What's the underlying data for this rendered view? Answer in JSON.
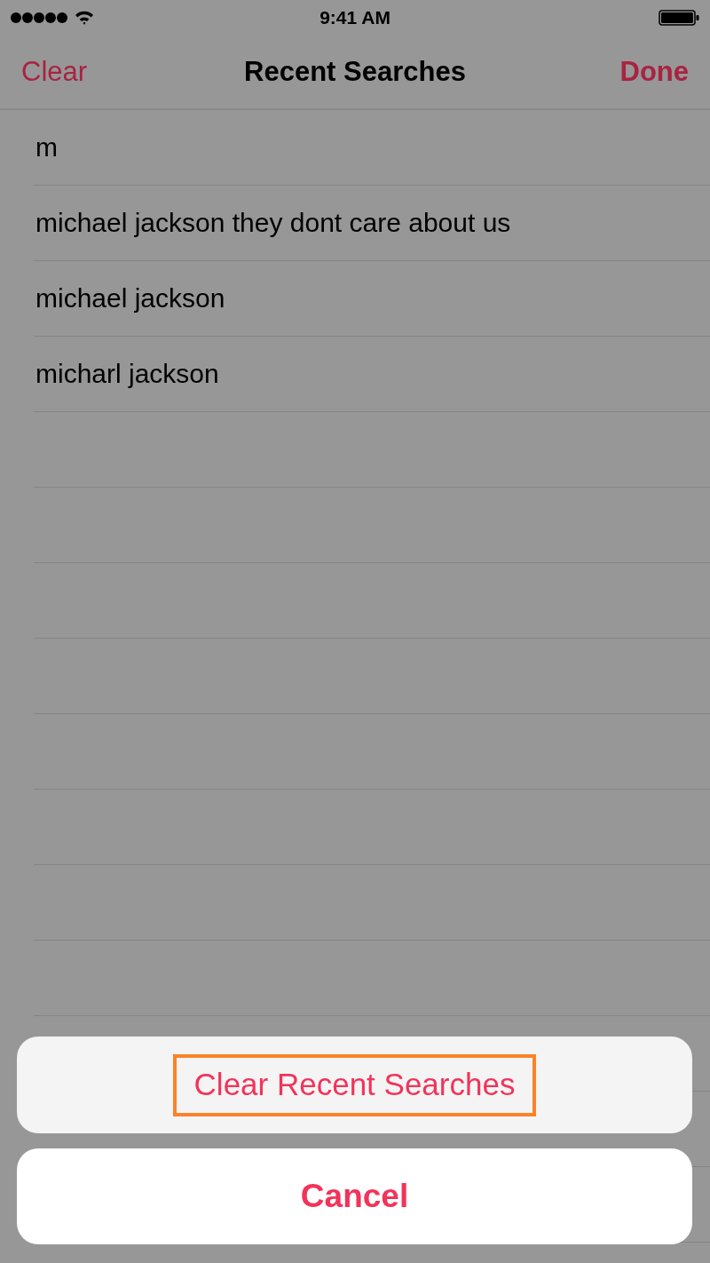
{
  "status_bar": {
    "time": "9:41 AM"
  },
  "nav": {
    "left": "Clear",
    "title": "Recent Searches",
    "right": "Done"
  },
  "searches": [
    "m",
    "michael jackson they dont care about us",
    "michael jackson",
    "micharl jackson"
  ],
  "action_sheet": {
    "actions": [
      {
        "label": "Clear Recent Searches",
        "kind": "destructive",
        "highlighted": true
      }
    ],
    "cancel": "Cancel"
  }
}
